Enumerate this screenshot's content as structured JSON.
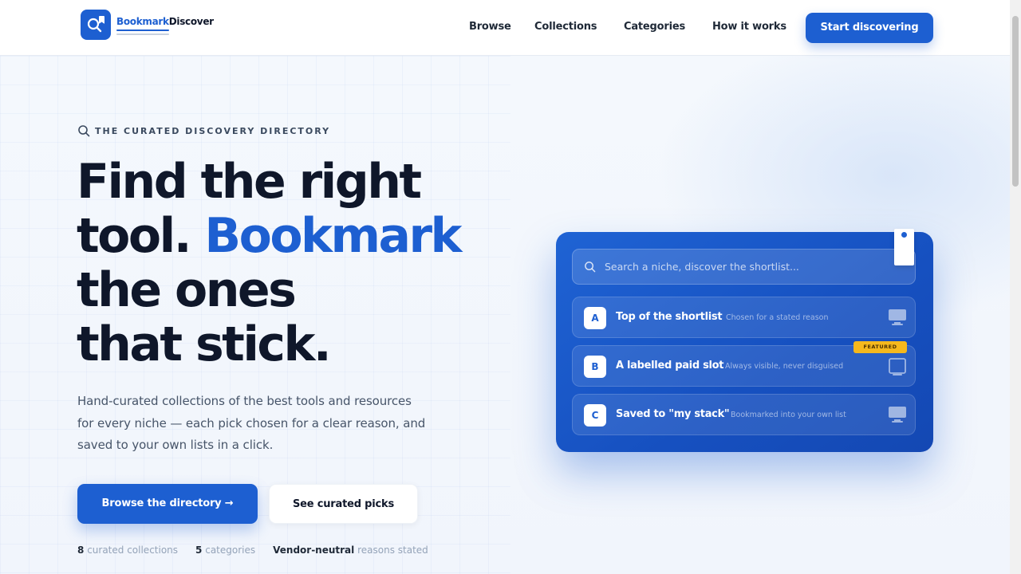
{
  "nav": {
    "logo_part1": "Bookmark",
    "logo_part2": "Discover",
    "links": [
      "Browse",
      "Collections",
      "Categories",
      "How it works"
    ],
    "cta": "Start discovering"
  },
  "hero": {
    "eyebrow": "THE CURATED DISCOVERY DIRECTORY",
    "headline_line1": "Find the right",
    "headline_tool": "tool. ",
    "headline_highlight": "Bookmark",
    "headline_line3": "the ones",
    "headline_line4": "that stick.",
    "subtext": "Hand-curated collections of the best tools and resources for every niche — each pick chosen for a clear reason, and saved to your own lists in a click.",
    "primary_button": "Browse the directory →",
    "secondary_button": "See curated picks",
    "stats": [
      {
        "value": "8",
        "label": "curated collections"
      },
      {
        "value": "5",
        "label": "categories"
      },
      {
        "value": "Vendor-neutral",
        "label": "reasons stated"
      }
    ]
  },
  "preview_card": {
    "search_placeholder": "Search a niche, discover the shortlist...",
    "featured_badge": "FEATURED",
    "rows": [
      {
        "letter": "A",
        "title": "Top of the shortlist",
        "desc": "Chosen for a stated reason",
        "icon": "monitor-icon"
      },
      {
        "letter": "B",
        "title": "A labelled paid slot",
        "desc": "Always visible, never disguised",
        "icon": "monitor-outline-icon"
      },
      {
        "letter": "C",
        "title": "Saved to \"my stack\"",
        "desc": "Bookmarked into your own list",
        "icon": "monitor-icon"
      }
    ]
  },
  "colors": {
    "accent": "#1d5fd1",
    "ink": "#0f172a",
    "badge": "#f5b81d"
  }
}
